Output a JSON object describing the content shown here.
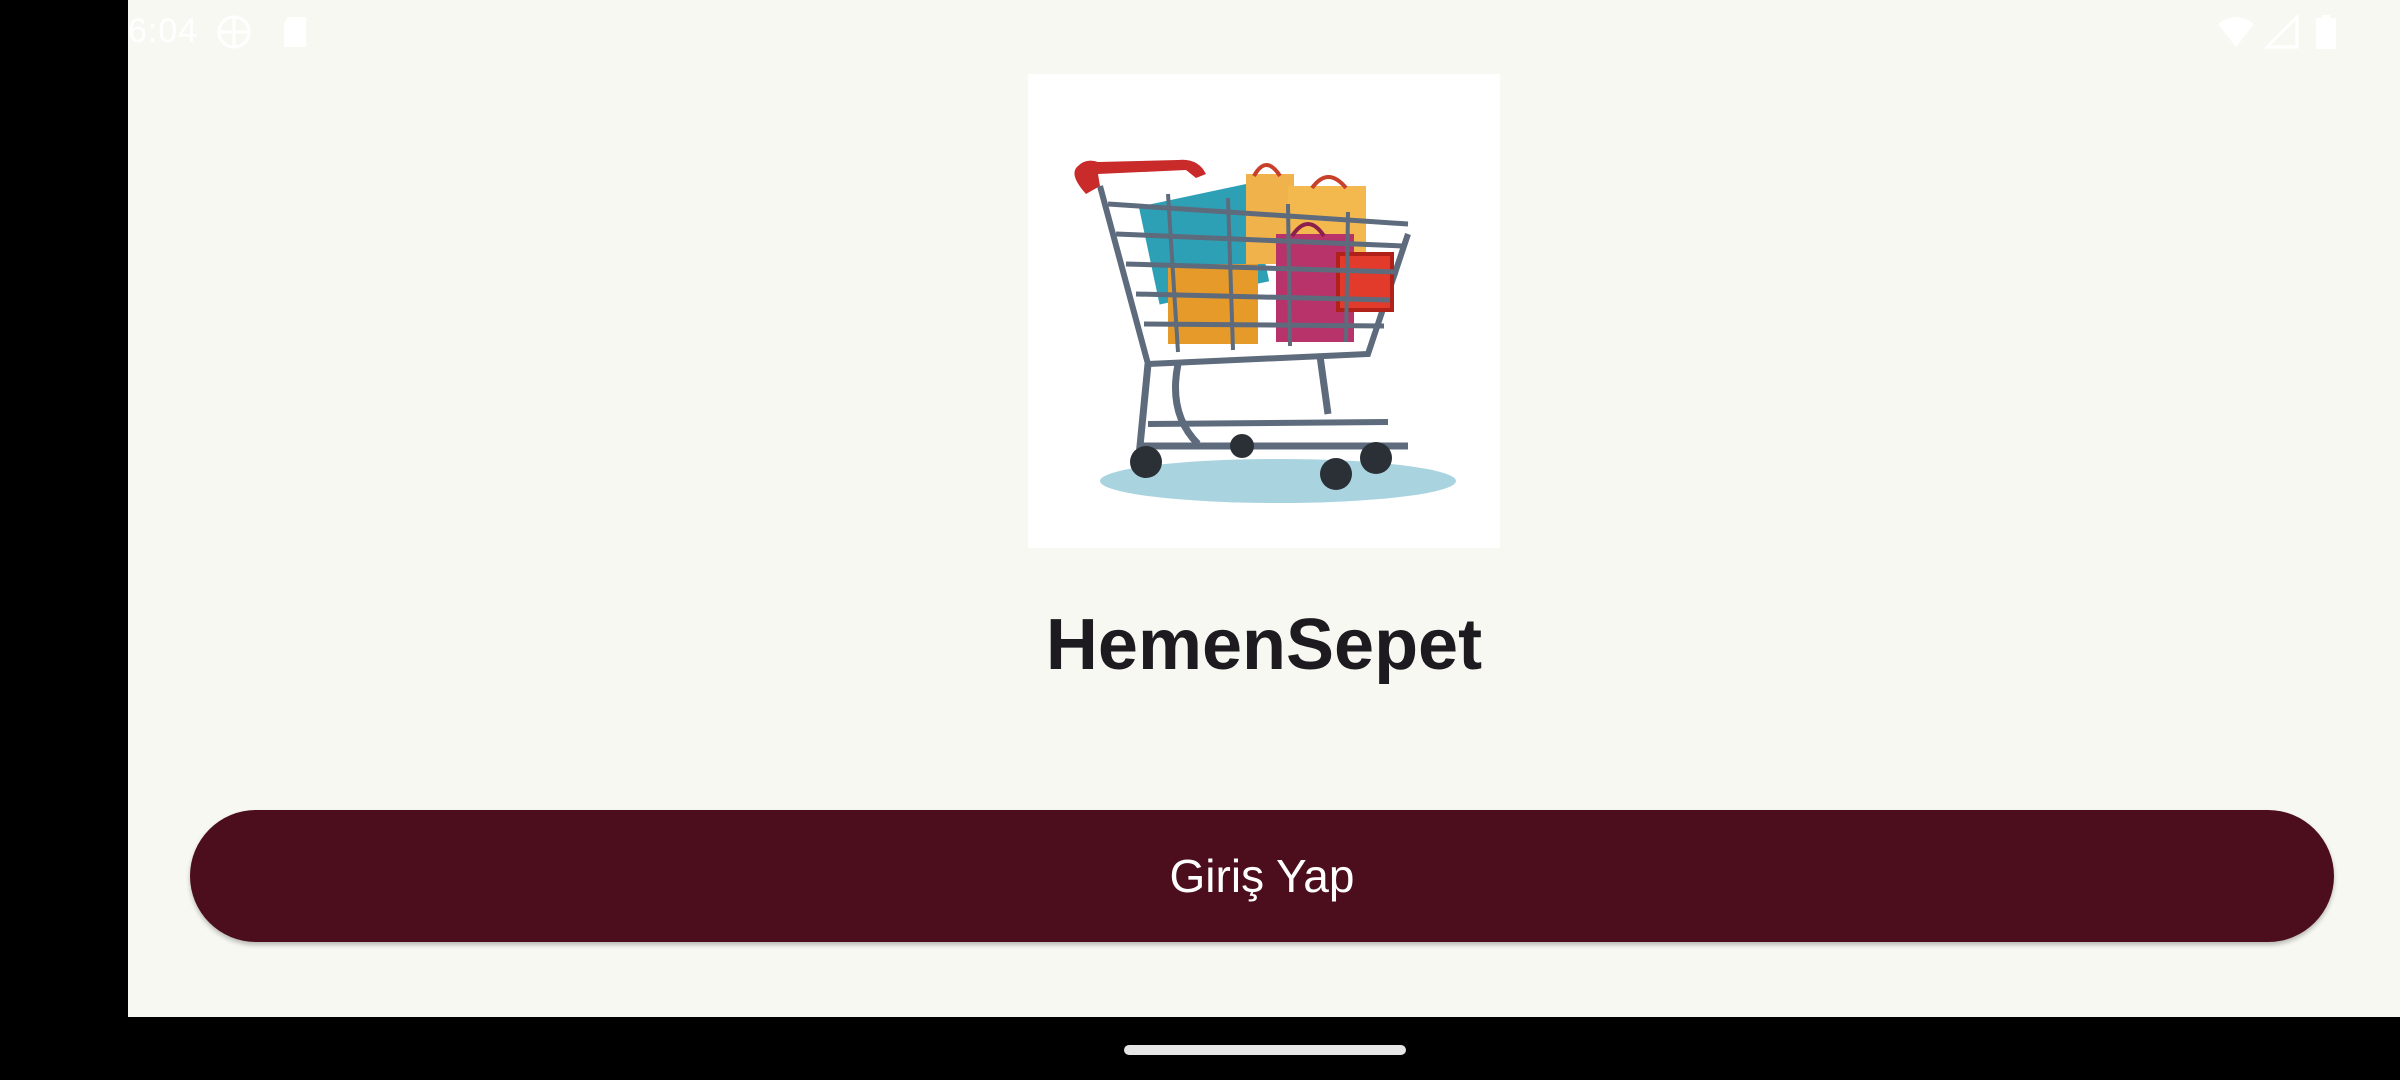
{
  "status_bar": {
    "time": "6:04",
    "icons": [
      "vpn-globe-icon",
      "sd-card-icon",
      "wifi-icon",
      "signal-icon",
      "battery-icon"
    ]
  },
  "app": {
    "name": "HemenSepet",
    "logo": "shopping-cart-icon"
  },
  "login_button": {
    "label": "Giriş Yap"
  },
  "colors": {
    "background": "#f8f8f3",
    "button": "#4c0e1d",
    "button_text": "#ffffff",
    "title": "#1d1b1f"
  }
}
